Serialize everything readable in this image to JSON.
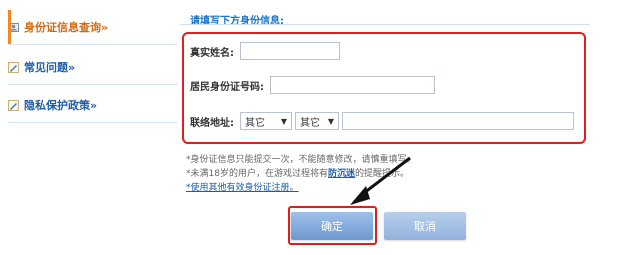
{
  "sidebar": {
    "items": [
      {
        "label": "身份证信息查询»",
        "icon": "id-card-icon"
      },
      {
        "label": "常见问题»",
        "icon": "pencil-icon"
      },
      {
        "label": "隐私保护政策»",
        "icon": "pencil-icon"
      }
    ]
  },
  "main": {
    "hint": "请填写下方身份信息:",
    "form": {
      "name_label": "真实姓名:",
      "name_value": "",
      "id_label": "居民身份证号码:",
      "id_value": "",
      "addr_label": "联络地址:",
      "province_selected": "其它",
      "city_selected": "其它",
      "addr_value": ""
    },
    "notes": {
      "line1": "*身份证信息只能提交一次，不能随意修改，请慎重填写。",
      "line2_pre": "*未满18岁的用户，在游戏过程将有",
      "line2_link": "防沉迷",
      "line2_post": "的提醒提示。",
      "line3": "*使用其他有效身份证注册。"
    },
    "buttons": {
      "ok": "确定",
      "cancel": "取消"
    }
  },
  "colors": {
    "highlight_red": "#e01e1e",
    "link_blue": "#1d5ea8",
    "button_blue": "#6d97cf"
  }
}
